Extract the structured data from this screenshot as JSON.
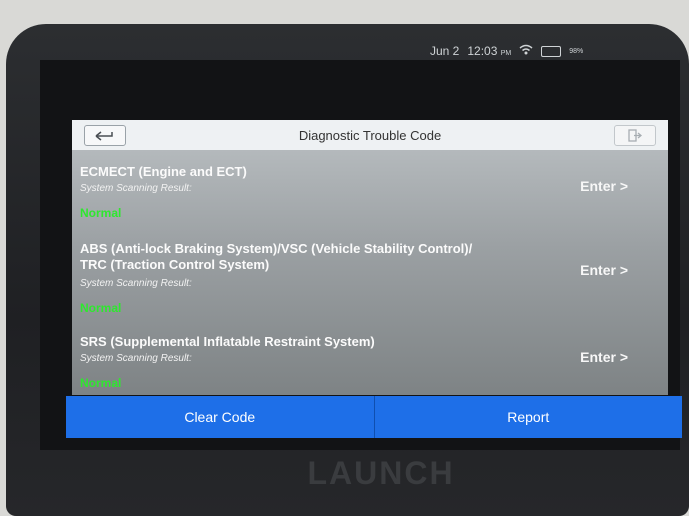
{
  "status_bar": {
    "date": "Jun 2",
    "time": "12:03",
    "ampm": "PM",
    "battery": "98%"
  },
  "header": {
    "title": "Diagnostic Trouble Code"
  },
  "systems": [
    {
      "name_lines": [
        "ECMECT (Engine and ECT)"
      ],
      "sub_label": "System Scanning Result:",
      "status": "Normal",
      "action": "Enter >"
    },
    {
      "name_lines": [
        "ABS (Anti-lock Braking System)/VSC (Vehicle Stability Control)/",
        "TRC (Traction Control System)"
      ],
      "sub_label": "System Scanning Result:",
      "status": "Normal",
      "action": "Enter >"
    },
    {
      "name_lines": [
        "SRS (Supplemental Inflatable Restraint System)"
      ],
      "sub_label": "System Scanning Result:",
      "status": "Normal",
      "action": "Enter >"
    }
  ],
  "buttons": {
    "clear_code": "Clear Code",
    "report": "Report"
  },
  "device": {
    "brand": "LAUNCH"
  },
  "colors": {
    "accent": "#1e6fe8",
    "normal": "#2ee82e"
  }
}
